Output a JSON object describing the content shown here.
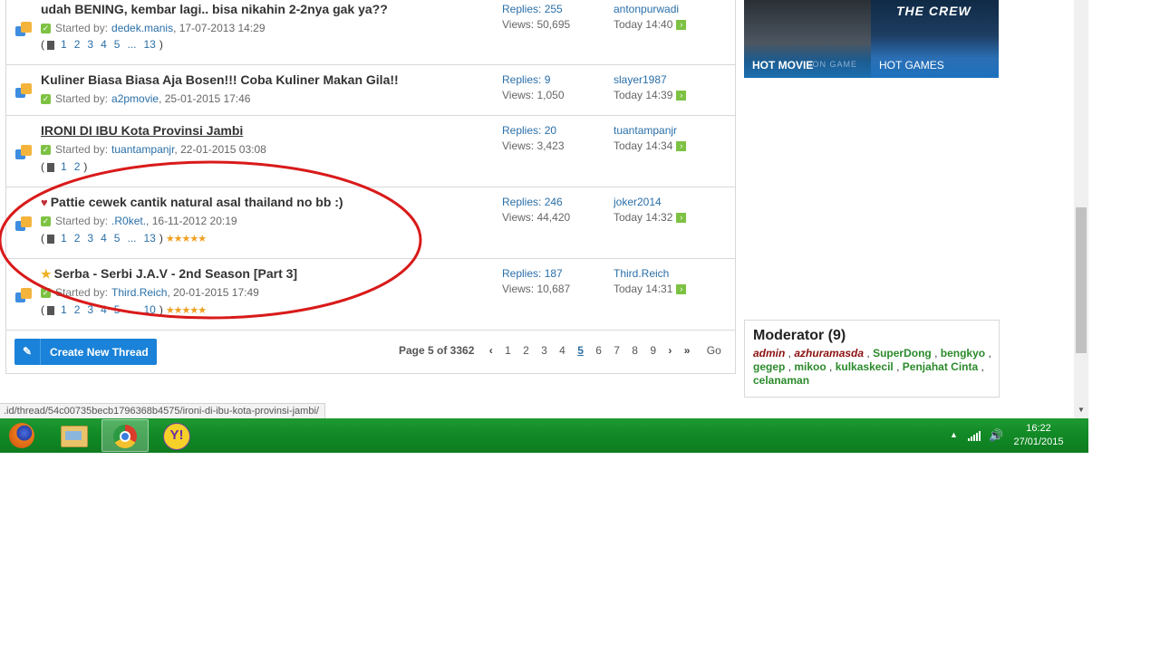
{
  "threads": [
    {
      "title": "udah BENING, kembar lagi.. bisa nikahin 2-2nya gak ya??",
      "prefix_icon": "",
      "underline": false,
      "started_label": "Started by:",
      "author": "dedek.manis",
      "date": ", 17-07-2013 14:29",
      "pages": [
        "1",
        "2",
        "3",
        "4",
        "5",
        "...",
        "13"
      ],
      "rating": "",
      "replies": "Replies: 255",
      "views": "Views: 50,695",
      "last_user": "antonpurwadi",
      "last_time": "Today 14:40"
    },
    {
      "title": "Kuliner Biasa Biasa Aja Bosen!!! Coba Kuliner Makan Gila!!",
      "prefix_icon": "",
      "underline": false,
      "started_label": "Started by:",
      "author": "a2pmovie",
      "date": ", 25-01-2015 17:46",
      "pages": [],
      "rating": "",
      "replies": "Replies: 9",
      "views": "Views: 1,050",
      "last_user": "slayer1987",
      "last_time": "Today 14:39"
    },
    {
      "title": "IRONI DI IBU Kota Provinsi Jambi",
      "prefix_icon": "",
      "underline": true,
      "started_label": "Started by:",
      "author": "tuantampanjr",
      "date": ", 22-01-2015 03:08",
      "pages": [
        "1",
        "2"
      ],
      "rating": "",
      "replies": "Replies: 20",
      "views": "Views: 3,423",
      "last_user": "tuantampanjr",
      "last_time": "Today 14:34"
    },
    {
      "title": "Pattie cewek cantik natural asal thailand no bb :)",
      "prefix_icon": "heart-icon",
      "underline": false,
      "started_label": "Started by:",
      "author": ".R0ket.",
      "date": ", 16-11-2012 20:19",
      "pages": [
        "1",
        "2",
        "3",
        "4",
        "5",
        "...",
        "13"
      ],
      "rating": "★★★★★",
      "replies": "Replies: 246",
      "views": "Views: 44,420",
      "last_user": "joker2014",
      "last_time": "Today 14:32"
    },
    {
      "title": "Serba - Serbi J.A.V - 2nd Season [Part 3]",
      "prefix_icon": "star-icon",
      "underline": false,
      "started_label": "Started by:",
      "author": "Third.Reich",
      "date": ", 20-01-2015 17:49",
      "pages": [
        "1",
        "2",
        "3",
        "4",
        "5",
        "...",
        "10"
      ],
      "rating": "★★★★★",
      "replies": "Replies: 187",
      "views": "Views: 10,687",
      "last_user": "Third.Reich",
      "last_time": "Today 14:31"
    }
  ],
  "bottom": {
    "new_thread_label": "Create New Thread",
    "page_info": "Page 5 of 3362",
    "pages": [
      "1",
      "2",
      "3",
      "4",
      "5",
      "6",
      "7",
      "8",
      "9"
    ],
    "current_page": "5",
    "go_label": "Go"
  },
  "sidebar": {
    "banner": {
      "hot_movie": "HOT MOVIE",
      "hot_games": "HOT GAMES",
      "game_title": "THE CREW",
      "ghost_text": "ION GAME"
    },
    "moderator": {
      "title": "Moderator (9)",
      "names": [
        "admin",
        "azhuramasda",
        "SuperDong",
        "bengkyo",
        "gegep",
        "mikoo",
        "kulkaskecil",
        "Penjahat Cinta",
        "celanaman"
      ],
      "italic_names": [
        "admin",
        "azhuramasda"
      ]
    }
  },
  "status_url": ".id/thread/54c00735becb1796368b4575/ironi-di-ibu-kota-provinsi-jambi/",
  "taskbar": {
    "apps": [
      "firefox",
      "file-explorer",
      "chrome",
      "yahoo-messenger"
    ],
    "active_app": "chrome",
    "time": "16:22",
    "date": "27/01/2015"
  },
  "colors": {
    "link": "#2a6fa8",
    "taskbar": "#128a26",
    "button": "#1a82d8",
    "moderator": "#2b8a2b",
    "admin": "#8b1010",
    "annotation": "#d91a1a"
  }
}
